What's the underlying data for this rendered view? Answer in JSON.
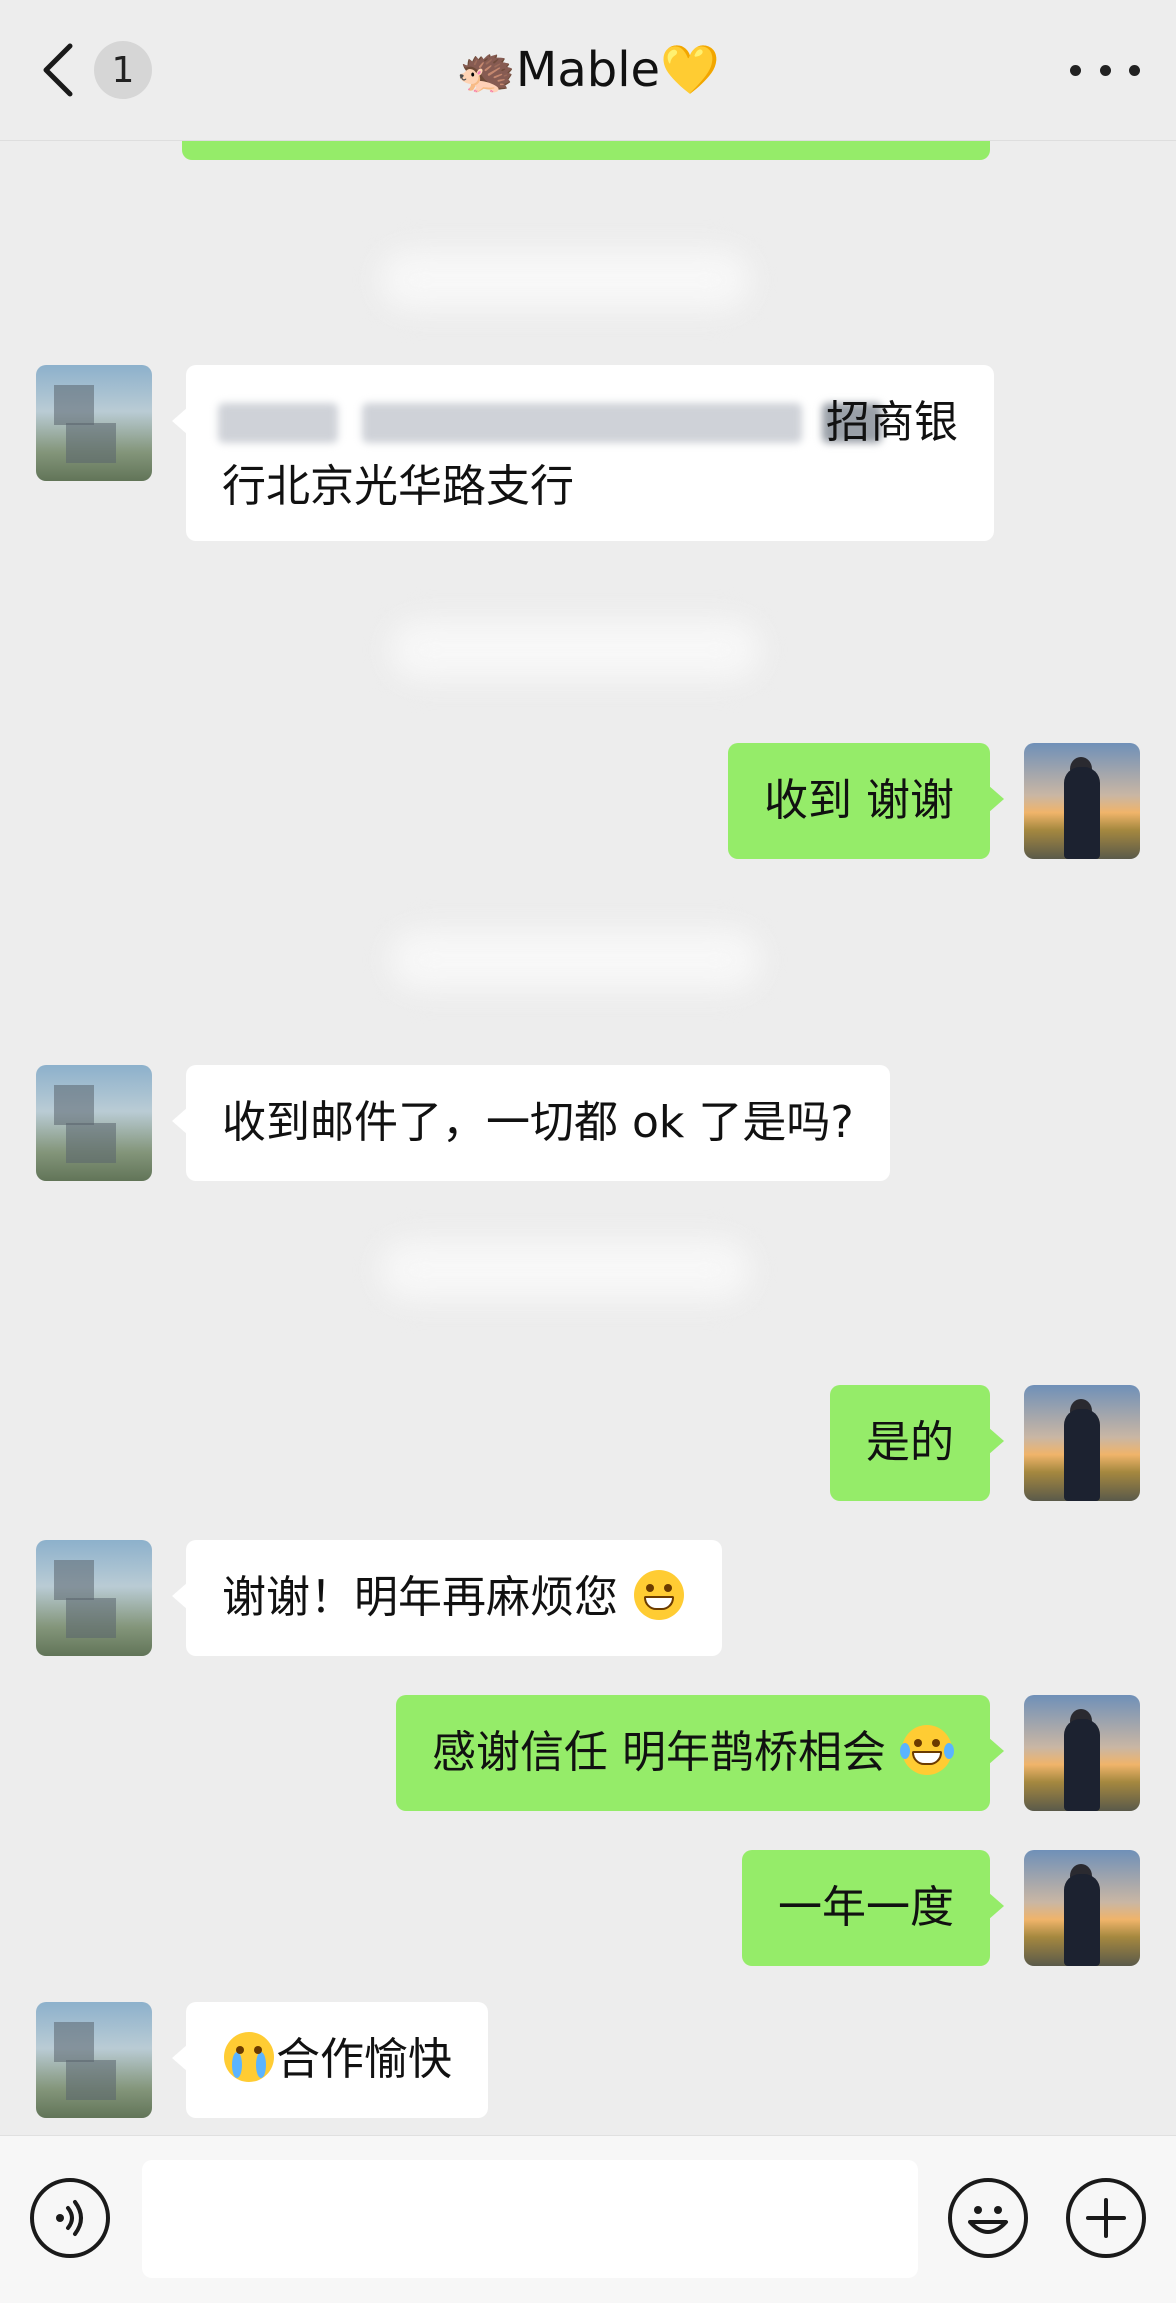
{
  "header": {
    "unread_count": "1",
    "title": "🦔Mable💛"
  },
  "messages": [
    {
      "side": "in",
      "text": "招商银行北京光华路支行",
      "text_line1_visible": "招商银",
      "text_line2": "行北京光华路支行"
    },
    {
      "side": "out",
      "text": "收到 谢谢"
    },
    {
      "side": "in",
      "text": "收到邮件了，一切都 ok 了是吗?"
    },
    {
      "side": "out",
      "text": "是的"
    },
    {
      "side": "in",
      "text": "谢谢！明年再麻烦您",
      "emoji": "grin-emoji"
    },
    {
      "side": "out",
      "text": "感谢信任 明年鹊桥相会 ",
      "emoji": "laugh-cry-emoji"
    },
    {
      "side": "out",
      "text": "一年一度"
    },
    {
      "side": "in",
      "text": "合作愉快",
      "emoji": "sob-emoji"
    }
  ],
  "input": {
    "value": "",
    "placeholder": ""
  },
  "icons": {
    "back": "chevron-left-icon",
    "more": "more-dots-icon",
    "voice": "voice-icon",
    "emoji": "emoji-icon",
    "plus": "plus-icon"
  },
  "colors": {
    "background": "#ededed",
    "bubble_out": "#95ec69",
    "bubble_in": "#ffffff"
  }
}
